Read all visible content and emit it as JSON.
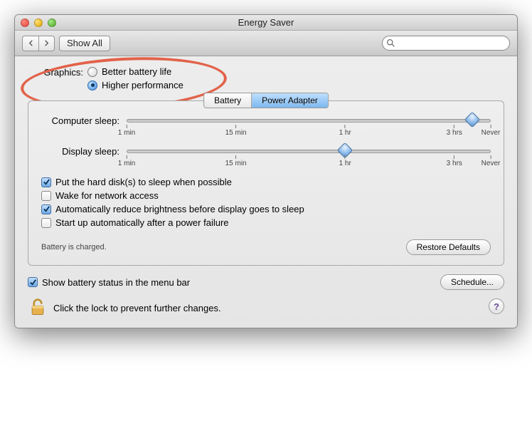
{
  "window": {
    "title": "Energy Saver"
  },
  "toolbar": {
    "show_all": "Show All",
    "search_placeholder": ""
  },
  "graphics": {
    "label": "Graphics:",
    "options": {
      "battery": {
        "label": "Better battery life",
        "selected": false
      },
      "performance": {
        "label": "Higher performance",
        "selected": true
      }
    }
  },
  "tabs": {
    "battery": {
      "label": "Battery",
      "active": false
    },
    "power_adapter": {
      "label": "Power Adapter",
      "active": true
    }
  },
  "sliders": {
    "computer_sleep": {
      "label": "Computer sleep:",
      "value_percent": 95,
      "ticks": {
        "t1": "1 min",
        "t2": "15 min",
        "t3": "1 hr",
        "t4": "3 hrs",
        "t5": "Never"
      }
    },
    "display_sleep": {
      "label": "Display sleep:",
      "value_percent": 60,
      "ticks": {
        "t1": "1 min",
        "t2": "15 min",
        "t3": "1 hr",
        "t4": "3 hrs",
        "t5": "Never"
      }
    }
  },
  "checks": {
    "hd_sleep": {
      "label": "Put the hard disk(s) to sleep when possible",
      "checked": true
    },
    "wake_network": {
      "label": "Wake for network access",
      "checked": false
    },
    "dim_brightness": {
      "label": "Automatically reduce brightness before display goes to sleep",
      "checked": true
    },
    "auto_start": {
      "label": "Start up automatically after a power failure",
      "checked": false
    },
    "show_menu": {
      "label": "Show battery status in the menu bar",
      "checked": true
    }
  },
  "status": {
    "battery": "Battery is charged."
  },
  "buttons": {
    "restore_defaults": "Restore Defaults",
    "schedule": "Schedule...",
    "help": "?"
  },
  "lock": {
    "text": "Click the lock to prevent further changes."
  }
}
